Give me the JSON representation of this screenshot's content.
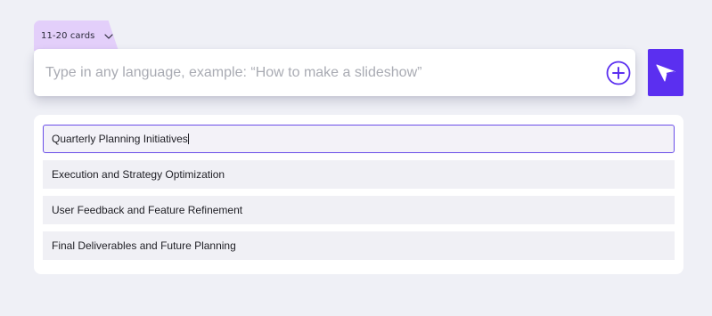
{
  "card_count": {
    "label": "11-20 cards",
    "icon": "chevron-down-icon"
  },
  "prompt": {
    "placeholder": "Type in any language, example: “How to make a slideshow”",
    "value": ""
  },
  "actions": {
    "add_icon": "plus-circle-icon",
    "send_icon": "send-icon"
  },
  "outline": {
    "items": [
      {
        "title": "Quarterly Planning Initiatives",
        "active": true
      },
      {
        "title": "Execution and Strategy Optimization",
        "active": false
      },
      {
        "title": "User Feedback and Feature Refinement",
        "active": false
      },
      {
        "title": "Final Deliverables and Future Planning",
        "active": false
      }
    ]
  },
  "colors": {
    "background": "#eff0f6",
    "accent": "#5b2ff0",
    "tab": "#e3cffa",
    "active_border": "#6a4ee8"
  }
}
